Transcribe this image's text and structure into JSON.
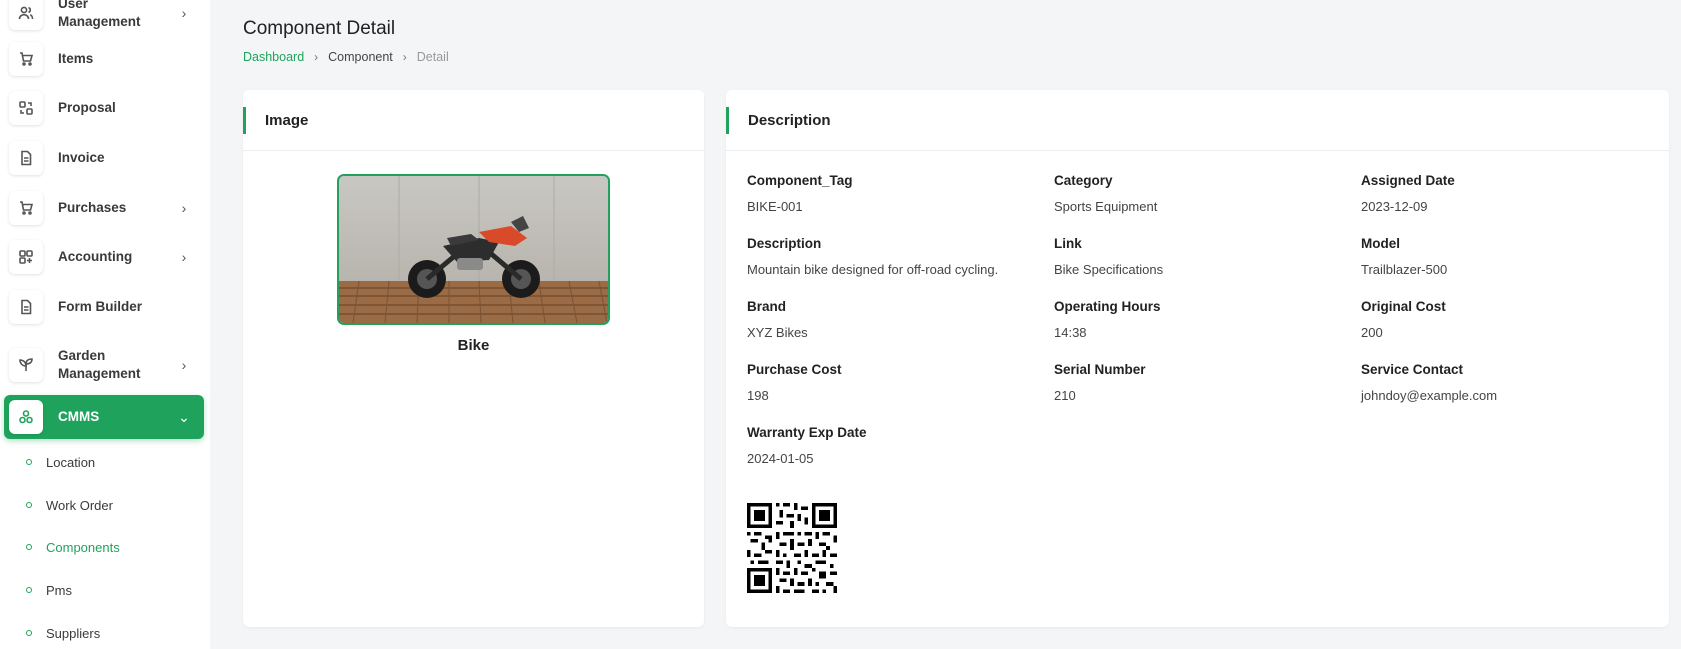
{
  "sidebar": {
    "items": [
      {
        "label": "User Management",
        "icon": "users-icon",
        "has_chevron": true,
        "chevron": "›"
      },
      {
        "label": "Items",
        "icon": "cart-icon",
        "has_chevron": false
      },
      {
        "label": "Proposal",
        "icon": "proposal-icon",
        "has_chevron": false
      },
      {
        "label": "Invoice",
        "icon": "document-icon",
        "has_chevron": false
      },
      {
        "label": "Purchases",
        "icon": "cart-icon",
        "has_chevron": true,
        "chevron": "›"
      },
      {
        "label": "Accounting",
        "icon": "grid-icon",
        "has_chevron": true,
        "chevron": "›"
      },
      {
        "label": "Form Builder",
        "icon": "document-icon",
        "has_chevron": false
      },
      {
        "label": "Garden Management",
        "icon": "plant-icon",
        "has_chevron": true,
        "chevron": "›"
      },
      {
        "label": "CMMS",
        "icon": "cmms-icon",
        "has_chevron": true,
        "chevron": "⌄",
        "active": true
      }
    ],
    "sub_items": [
      {
        "label": "Location"
      },
      {
        "label": "Work Order"
      },
      {
        "label": "Components",
        "current": true
      },
      {
        "label": "Pms"
      },
      {
        "label": "Suppliers"
      }
    ]
  },
  "header": {
    "title": "Component Detail",
    "breadcrumb": [
      "Dashboard",
      "Component",
      "Detail"
    ]
  },
  "image_card": {
    "title": "Image",
    "caption": "Bike"
  },
  "description_card": {
    "title": "Description",
    "fields": [
      {
        "label": "Component_Tag",
        "value": "BIKE-001"
      },
      {
        "label": "Category",
        "value": "Sports Equipment"
      },
      {
        "label": "Assigned Date",
        "value": "2023-12-09"
      },
      {
        "label": "Description",
        "value": "Mountain bike designed for off-road cycling."
      },
      {
        "label": "Link",
        "value": "Bike Specifications"
      },
      {
        "label": "Model",
        "value": "Trailblazer-500"
      },
      {
        "label": "Brand",
        "value": "XYZ Bikes"
      },
      {
        "label": "Operating Hours",
        "value": "14:38"
      },
      {
        "label": "Original Cost",
        "value": "200"
      },
      {
        "label": "Purchase Cost",
        "value": "198"
      },
      {
        "label": "Serial Number",
        "value": "210"
      },
      {
        "label": "Service Contact",
        "value": "johndoy@example.com"
      },
      {
        "label": "Warranty Exp Date",
        "value": "2024-01-05"
      }
    ]
  },
  "colors": {
    "accent": "#1fa35c",
    "background": "#f4f5f7",
    "card": "#ffffff"
  }
}
